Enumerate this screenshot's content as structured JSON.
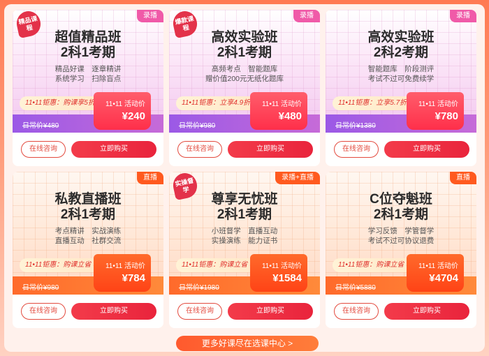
{
  "cards": [
    {
      "tag": "录播",
      "badge": "精品课程",
      "title1": "超值精品班",
      "title2": "2科1考期",
      "feat1": "精品好课　逐章精讲",
      "feat2": "系统学习　扫除盲点",
      "promo": "11•11钜惠：购课享5折优惠",
      "activity": "11•11 活动价",
      "price": "¥240",
      "original": "日常价¥480",
      "consult": "在线咨询",
      "buy": "立即购买"
    },
    {
      "tag": "录播",
      "badge": "爆款课程",
      "title1": "高效实验班",
      "title2": "2科1考期",
      "feat1": "高频考点　智能题库",
      "feat2": "赠价值200元无纸化题库",
      "promo": "11•11钜惠：立享4.9折优惠",
      "activity": "11•11 活动价",
      "price": "¥480",
      "original": "日常价¥980",
      "consult": "在线咨询",
      "buy": "立即购买"
    },
    {
      "tag": "录播",
      "badge": "",
      "title1": "高效实验班",
      "title2": "2科2考期",
      "feat1": "智能题库　阶段测评",
      "feat2": "考试不过可免费续学",
      "promo": "11•11钜惠：立享5.7折优惠",
      "activity": "11•11 活动价",
      "price": "¥780",
      "original": "日常价¥1380",
      "consult": "在线咨询",
      "buy": "立即购买"
    },
    {
      "tag": "直播",
      "badge": "",
      "title1": "私教直播班",
      "title2": "2科1考期",
      "feat1": "考点精讲　实战演练",
      "feat2": "直播互动　社群交流",
      "promo": "11•11钜惠：购课立省 再减券",
      "activity": "11•11 活动价",
      "price": "¥784",
      "original": "日常价¥980",
      "consult": "在线咨询",
      "buy": "立即购买"
    },
    {
      "tag": "录播+直播",
      "badge": "实操督学",
      "title1": "尊享无忧班",
      "title2": "2科1考期",
      "feat1": "小班督学　直播互动",
      "feat2": "实操演练　能力证书",
      "promo": "11•11钜惠：购课立省 再减券",
      "activity": "11•11 活动价",
      "price": "¥1584",
      "original": "日常价¥1980",
      "consult": "在线咨询",
      "buy": "立即购买"
    },
    {
      "tag": "直播",
      "badge": "",
      "title1": "C位夺魁班",
      "title2": "2科1考期",
      "feat1": "学习反馈　学管督学",
      "feat2": "考试不过可协议退费",
      "promo": "11•11钜惠：购课立省 再减券",
      "activity": "11•11 活动价",
      "price": "¥4704",
      "original": "日常价¥5880",
      "consult": "在线咨询",
      "buy": "立即购买"
    }
  ],
  "more_button": "更多好课尽在选课中心 >",
  "colors": {
    "accent_red": "#e9243c",
    "accent_orange": "#ff5a1f",
    "purple_band": "#9b59e6"
  }
}
